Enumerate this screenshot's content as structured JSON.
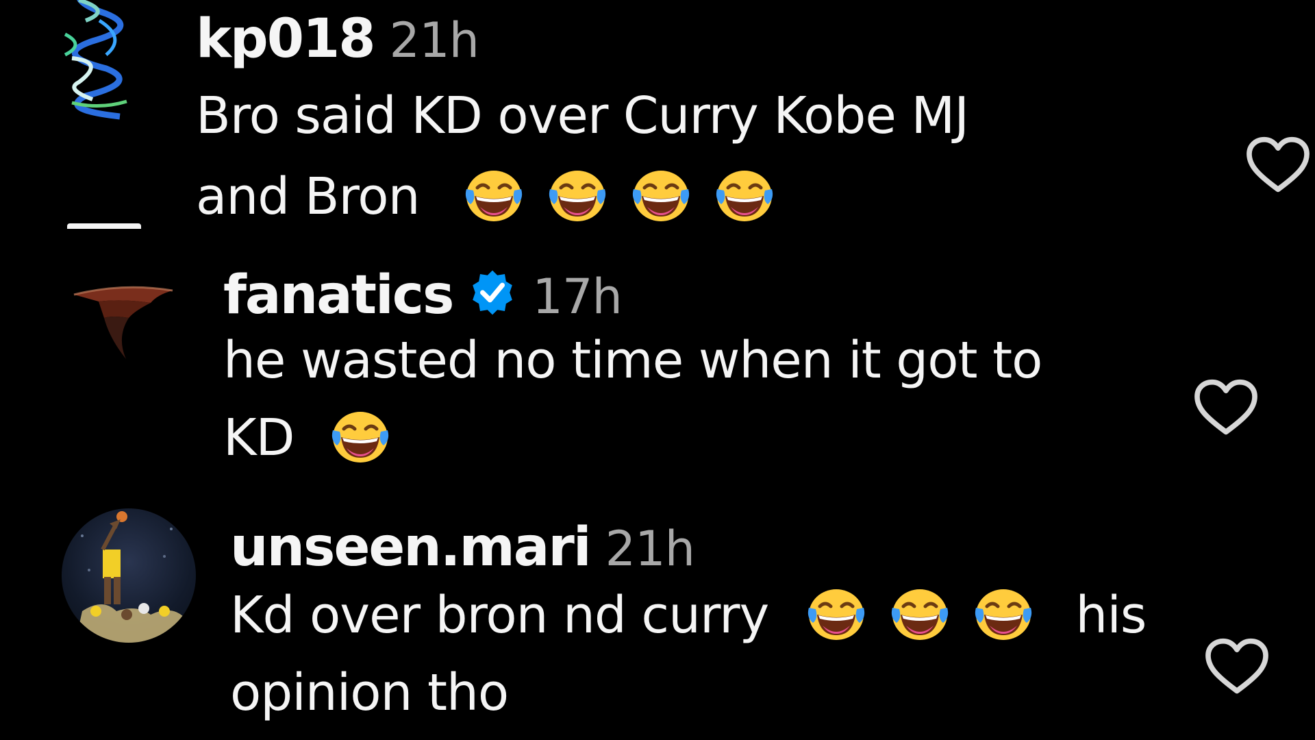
{
  "comments": [
    {
      "username": "kp018",
      "time": "21h",
      "text_line1": "Bro said KD over Curry Kobe MJ",
      "text_line2": "and Bron",
      "avatar_icon": "neon-squiggle-avatar",
      "emoji_icon": "face-with-tears-of-joy-icon",
      "heart_icon": "heart-outline-icon"
    },
    {
      "username": "fanatics",
      "verified": true,
      "time": "17h",
      "text_line1": "he wasted no time when it got to",
      "text_line2": "KD",
      "avatar_icon": "fanatics-logo-avatar",
      "emoji_icon": "face-with-tears-of-joy-icon",
      "heart_icon": "heart-outline-icon"
    },
    {
      "username": "unseen.mari",
      "time": "21h",
      "text_line1": "Kd over bron nd curry",
      "text_line1_tail": "his",
      "text_line2": "opinion tho",
      "avatar_icon": "basketball-dunk-photo-avatar",
      "emoji_icon": "face-with-tears-of-joy-icon",
      "heart_icon": "heart-outline-icon"
    }
  ],
  "colors": {
    "background": "#000000",
    "text": "#f5f5f5",
    "timestamp": "#a8a8a8",
    "verified_badge": "#0095f6"
  }
}
